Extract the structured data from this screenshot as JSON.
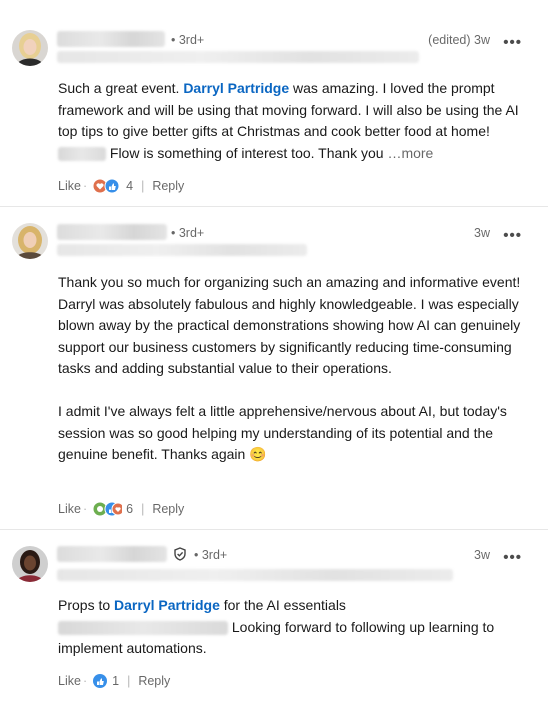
{
  "comments": [
    {
      "degree": "• 3rd+",
      "time": "(edited) 3w",
      "menu": "•••",
      "text": {
        "p1": "Such a great event. ",
        "mention": "Darryl Partridge",
        "p2": " was amazing. I loved the prompt framework and will be using that moving forward. I will also be using the AI top tips to give better gifts at Christmas and cook better food at home! ",
        "p3": " Flow is something of interest too. Thank you ",
        "more": "…more"
      },
      "like": "Like",
      "reaction_count": "4",
      "reply": "Reply"
    },
    {
      "degree": "• 3rd+",
      "time": "3w",
      "menu": "•••",
      "text": {
        "para1": "Thank you so much for organizing such an amazing and informative event! Darryl was absolutely fabulous and highly knowledgeable. I was especially blown away by the practical demonstrations showing how AI can genuinely support our business customers by significantly reducing time-consuming tasks and adding substantial value to their operations.",
        "para2": "I admit I've always felt a little apprehensive/nervous about AI, but today's session was so good helping my understanding of its potential and the genuine benefit. Thanks again 😊"
      },
      "like": "Like",
      "reaction_count": "6",
      "reply": "Reply"
    },
    {
      "degree": "• 3rd+",
      "time": "3w",
      "menu": "•••",
      "text": {
        "p1": "Props to ",
        "mention": "Darryl Partridge",
        "p2": " for the AI essentials",
        "p3": "Looking forward to following up learning to implement automations."
      },
      "like": "Like",
      "reaction_count": "1",
      "reply": "Reply"
    }
  ],
  "colors": {
    "link": "#0a66c2",
    "like_blue": "#378fe9",
    "love_red": "#df704d",
    "celebrate_green": "#6dae4f"
  }
}
